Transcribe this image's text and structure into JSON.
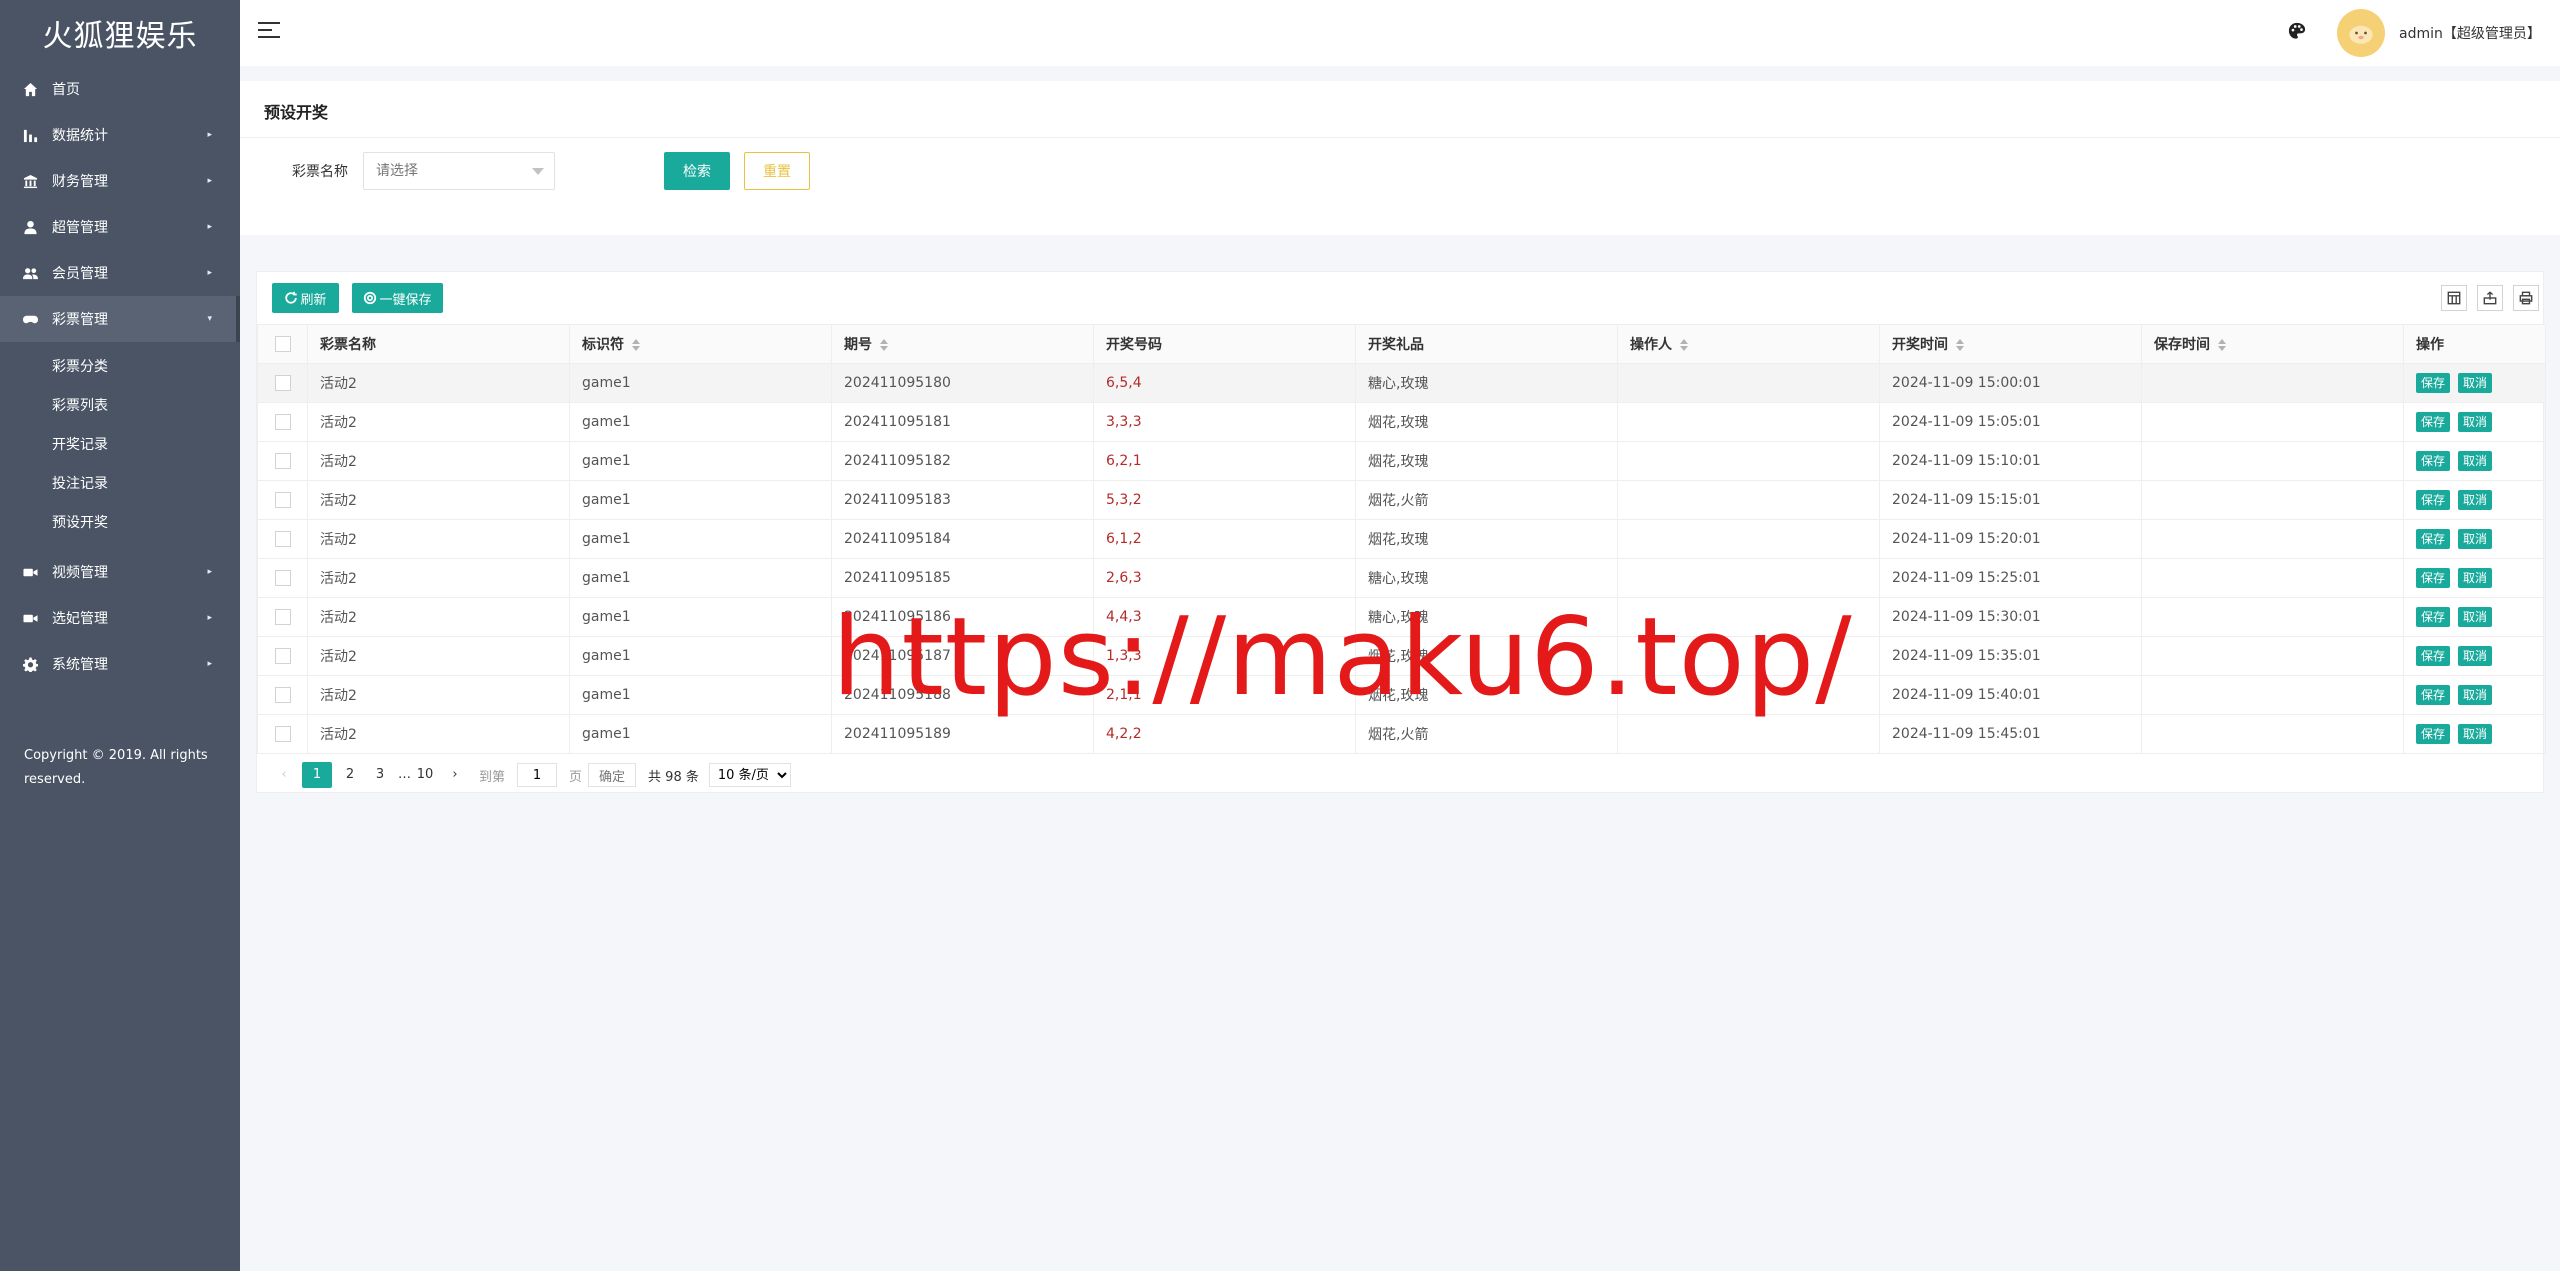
{
  "brand": "火狐狸娱乐",
  "sidebar": {
    "items": [
      {
        "label": "首页",
        "icon": "home-icon"
      },
      {
        "label": "数据统计",
        "icon": "bar-chart-icon"
      },
      {
        "label": "财务管理",
        "icon": "bank-icon"
      },
      {
        "label": "超管管理",
        "icon": "user-icon"
      },
      {
        "label": "会员管理",
        "icon": "users-icon"
      },
      {
        "label": "彩票管理",
        "icon": "gamepad-icon"
      },
      {
        "label": "视频管理",
        "icon": "video-icon"
      },
      {
        "label": "选妃管理",
        "icon": "video-icon"
      },
      {
        "label": "系统管理",
        "icon": "gear-icon"
      }
    ],
    "subitems": [
      "彩票分类",
      "彩票列表",
      "开奖记录",
      "投注记录",
      "预设开奖"
    ],
    "copyright": "Copyright © 2019. All rights reserved."
  },
  "header": {
    "user": "admin【超级管理员】"
  },
  "search": {
    "title": "预设开奖",
    "label": "彩票名称",
    "placeholder": "请选择",
    "search_label": "检索",
    "reset_label": "重置"
  },
  "toolbar": {
    "refresh_label": "刷新",
    "saveall_label": "一键保存"
  },
  "table": {
    "headers": [
      "彩票名称",
      "标识符",
      "期号",
      "开奖号码",
      "开奖礼品",
      "操作人",
      "开奖时间",
      "保存时间",
      "操作"
    ],
    "save_label": "保存",
    "cancel_label": "取消",
    "rows": [
      {
        "name": "活动2",
        "code": "game1",
        "issue": "202411095180",
        "number": "6,5,4",
        "gift": "糖心,玫瑰",
        "operator": "",
        "time": "2024-11-09 15:00:01",
        "saved": ""
      },
      {
        "name": "活动2",
        "code": "game1",
        "issue": "202411095181",
        "number": "3,3,3",
        "gift": "烟花,玫瑰",
        "operator": "",
        "time": "2024-11-09 15:05:01",
        "saved": ""
      },
      {
        "name": "活动2",
        "code": "game1",
        "issue": "202411095182",
        "number": "6,2,1",
        "gift": "烟花,玫瑰",
        "operator": "",
        "time": "2024-11-09 15:10:01",
        "saved": ""
      },
      {
        "name": "活动2",
        "code": "game1",
        "issue": "202411095183",
        "number": "5,3,2",
        "gift": "烟花,火箭",
        "operator": "",
        "time": "2024-11-09 15:15:01",
        "saved": ""
      },
      {
        "name": "活动2",
        "code": "game1",
        "issue": "202411095184",
        "number": "6,1,2",
        "gift": "烟花,玫瑰",
        "operator": "",
        "time": "2024-11-09 15:20:01",
        "saved": ""
      },
      {
        "name": "活动2",
        "code": "game1",
        "issue": "202411095185",
        "number": "2,6,3",
        "gift": "糖心,玫瑰",
        "operator": "",
        "time": "2024-11-09 15:25:01",
        "saved": ""
      },
      {
        "name": "活动2",
        "code": "game1",
        "issue": "202411095186",
        "number": "4,4,3",
        "gift": "糖心,玫瑰",
        "operator": "",
        "time": "2024-11-09 15:30:01",
        "saved": ""
      },
      {
        "name": "活动2",
        "code": "game1",
        "issue": "202411095187",
        "number": "1,3,3",
        "gift": "烟花,玫瑰",
        "operator": "",
        "time": "2024-11-09 15:35:01",
        "saved": ""
      },
      {
        "name": "活动2",
        "code": "game1",
        "issue": "202411095188",
        "number": "2,1,1",
        "gift": "烟花,玫瑰",
        "operator": "",
        "time": "2024-11-09 15:40:01",
        "saved": ""
      },
      {
        "name": "活动2",
        "code": "game1",
        "issue": "202411095189",
        "number": "4,2,2",
        "gift": "烟花,火箭",
        "operator": "",
        "time": "2024-11-09 15:45:01",
        "saved": ""
      }
    ]
  },
  "pager": {
    "pages": [
      "1",
      "2",
      "3"
    ],
    "ellipsis": "…",
    "last": "10",
    "goto_label": "到第",
    "goto_value": "1",
    "page_unit": "页",
    "confirm_label": "确定",
    "total": "共 98 条",
    "size_option": "10 条/页"
  },
  "watermark": "https://maku6.top/",
  "colors": {
    "sidebar": "#4a5464",
    "accent": "#1aaa9c",
    "reset": "#e8c240",
    "number": "#b32b2b",
    "watermark": "#e41a1a"
  }
}
